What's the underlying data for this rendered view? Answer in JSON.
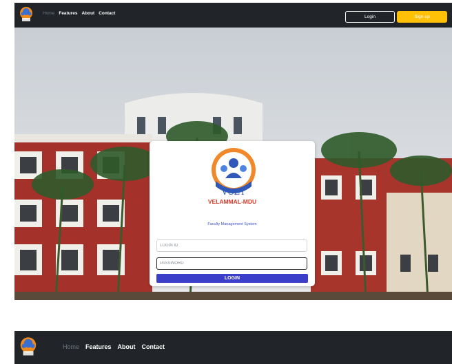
{
  "navbar": {
    "logo_icon": "vcet-logo-icon",
    "links": {
      "home": "Home",
      "features": "Features",
      "about": "About",
      "contact": "Contact"
    },
    "login_label": "Login",
    "signup_label": "Sign-up"
  },
  "hero": {
    "background_icon": "campus-building-photo"
  },
  "login_card": {
    "logo_text": "VCET",
    "brand": "VELAMMAL-MDU",
    "subtitle": "Faculty Management System",
    "login_id_placeholder": "LOGIN ID",
    "password_placeholder": "PASSWORD",
    "submit_label": "LOGIN"
  },
  "colors": {
    "navbar_bg": "#212529",
    "signup_bg": "#ffc107",
    "submit_bg": "#3b3ec9",
    "brand_red": "#d63a2a",
    "subtitle_blue": "#3b4bc8"
  }
}
